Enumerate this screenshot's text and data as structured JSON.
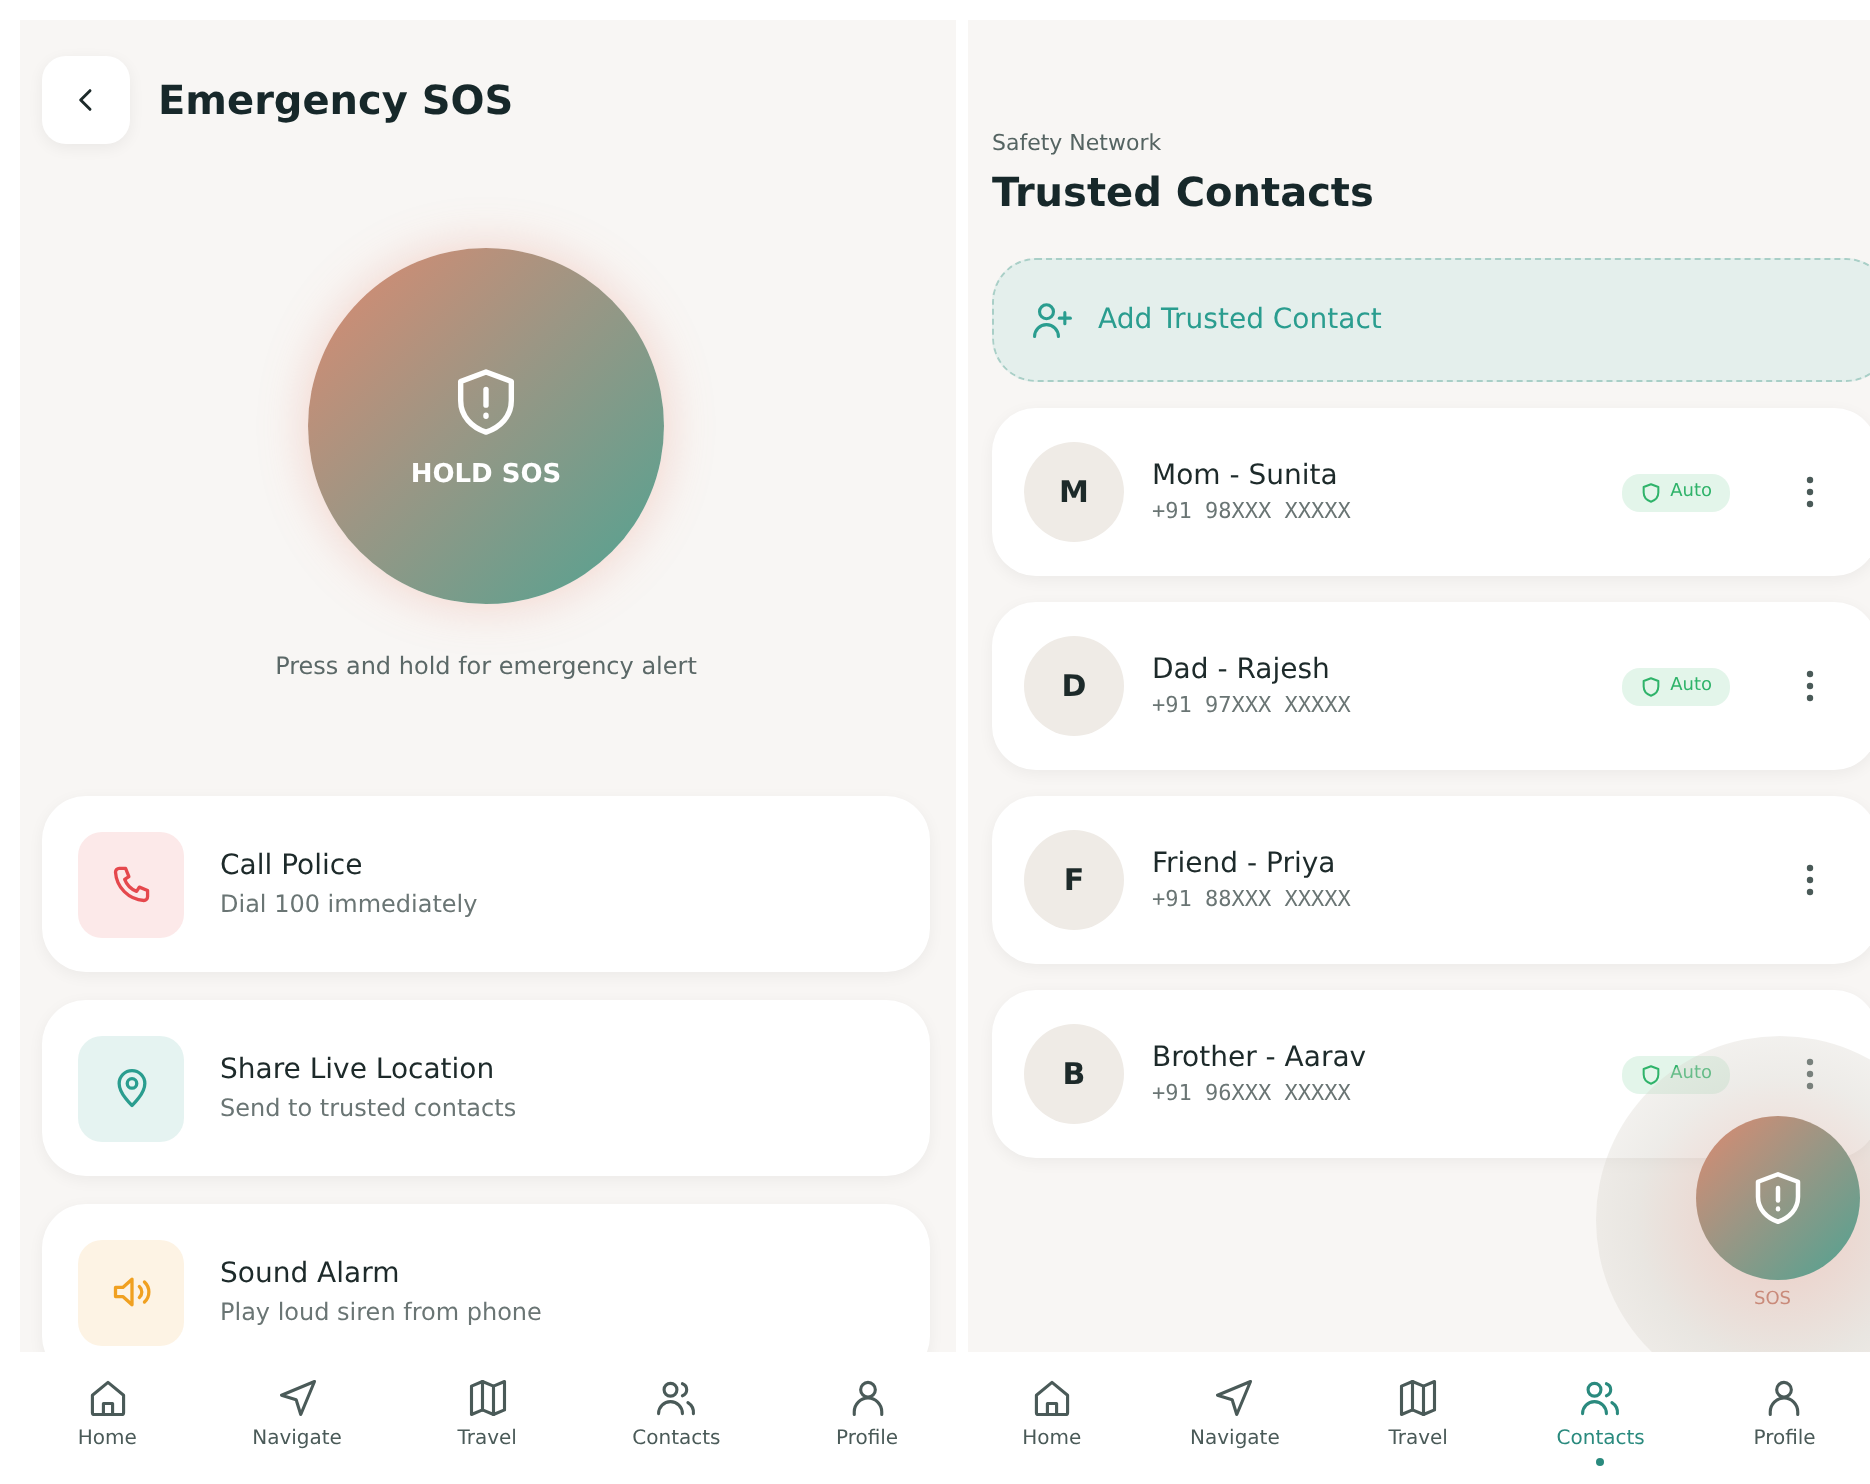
{
  "sos_screen": {
    "title": "Emergency SOS",
    "sos_button": "HOLD SOS",
    "caption": "Press and hold for emergency alert",
    "actions": [
      {
        "kind": "phone",
        "title": "Call Police",
        "subtitle": "Dial 100 immediately",
        "color": "#e5484d"
      },
      {
        "kind": "location",
        "title": "Share Live Location",
        "subtitle": "Send to trusted contacts",
        "color": "#2a9d8f"
      },
      {
        "kind": "alarm",
        "title": "Sound Alarm",
        "subtitle": "Play loud siren from phone",
        "color": "#f0a020"
      }
    ],
    "nav": [
      {
        "kind": "home",
        "label": "Home",
        "selected": false
      },
      {
        "kind": "navigate",
        "label": "Navigate",
        "selected": false
      },
      {
        "kind": "travel",
        "label": "Travel",
        "selected": false
      },
      {
        "kind": "contacts",
        "label": "Contacts",
        "selected": false
      },
      {
        "kind": "profile",
        "label": "Profile",
        "selected": false
      }
    ]
  },
  "contacts_screen": {
    "subtitle": "Safety Network",
    "title": "Trusted Contacts",
    "add_button": "Add Trusted Contact",
    "contacts": [
      {
        "initial": "M",
        "name": "Mom - Sunita",
        "phone": "+91 98XXX XXXXX",
        "auto": true,
        "badge": "Auto"
      },
      {
        "initial": "D",
        "name": "Dad - Rajesh",
        "phone": "+91 97XXX XXXXX",
        "auto": true,
        "badge": "Auto"
      },
      {
        "initial": "F",
        "name": "Friend - Priya",
        "phone": "+91 88XXX XXXXX",
        "auto": false
      },
      {
        "initial": "B",
        "name": "Brother - Aarav",
        "phone": "+91 96XXX XXXXX",
        "auto": true,
        "badge": "Auto"
      }
    ],
    "sos_fab": "SOS",
    "nav": [
      {
        "kind": "home",
        "label": "Home",
        "selected": false
      },
      {
        "kind": "navigate",
        "label": "Navigate",
        "selected": false
      },
      {
        "kind": "travel",
        "label": "Travel",
        "selected": false
      },
      {
        "kind": "contacts",
        "label": "Contacts",
        "selected": true
      },
      {
        "kind": "profile",
        "label": "Profile",
        "selected": false
      }
    ]
  }
}
